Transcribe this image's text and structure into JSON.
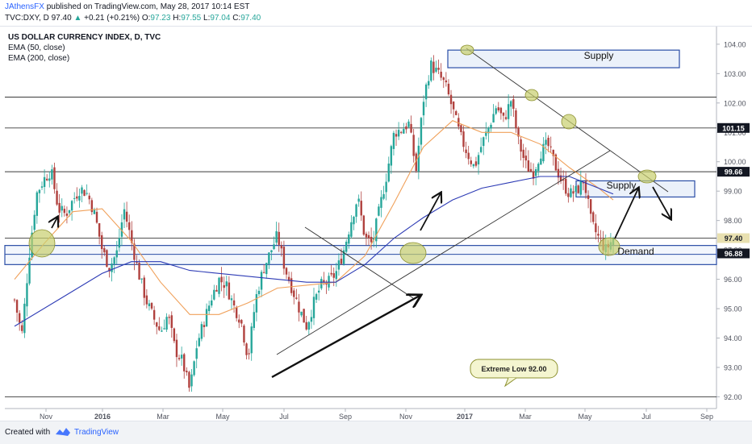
{
  "header": {
    "author": "JAthensFX",
    "published": "published on TradingView.com, May 28, 2017 10:14 EST",
    "symbol": "TVC:DXY, D",
    "last": "97.40",
    "change_arrow": "▲",
    "change": "+0.21 (+0.21%)",
    "o_label": "O:",
    "o_val": "97.23",
    "h_label": "H:",
    "h_val": "97.55",
    "l_label": "L:",
    "l_val": "97.04",
    "c_label": "C:",
    "c_val": "97.40"
  },
  "legend": {
    "title": "US DOLLAR CURRENCY INDEX, D, TVC",
    "ema1": "EMA (50, close)",
    "ema2": "EMA (200, close)"
  },
  "footer": {
    "created": "Created with",
    "brand": "TradingView"
  },
  "colors": {
    "bull": "#26a69a",
    "bear": "#b0413e",
    "ema50": "#f0a15b",
    "ema200": "#2d3bb5",
    "zone_border": "#2a4ea6",
    "zone_fill": "#e8eef9",
    "highlight": "#c8cf6e"
  },
  "chart_data": {
    "type": "candlestick",
    "title": "US DOLLAR CURRENCY INDEX, D, TVC",
    "y_axis": {
      "ticks": [
        "104.00",
        "103.00",
        "102.00",
        "101.00",
        "100.00",
        "99.00",
        "98.00",
        "97.00",
        "96.00",
        "95.00",
        "94.00",
        "93.00",
        "92.00"
      ],
      "ylim": [
        91.6,
        104.6
      ]
    },
    "x_axis": {
      "ticks": [
        "Nov",
        "2016",
        "Mar",
        "May",
        "Jul",
        "Sep",
        "Nov",
        "2017",
        "Mar",
        "May",
        "Jul",
        "Sep"
      ]
    },
    "price_labels": [
      "101.15",
      "99.66",
      "97.40",
      "96.88"
    ],
    "horizontal_levels": [
      101.15,
      102.2,
      99.66,
      97.4,
      92.0
    ],
    "zones": [
      {
        "label": "Supply",
        "low": 103.2,
        "high": 103.8
      },
      {
        "label": "Supply",
        "low": 98.8,
        "high": 99.35
      },
      {
        "label": "Demand",
        "low": 96.5,
        "high": 97.15
      }
    ],
    "close_path": [
      [
        0,
        95.3
      ],
      [
        1,
        94.1
      ],
      [
        2,
        96.8
      ],
      [
        3,
        98.9
      ],
      [
        4,
        99.4
      ],
      [
        5,
        99.7
      ],
      [
        6,
        98.4
      ],
      [
        7,
        98.2
      ],
      [
        8,
        98.7
      ],
      [
        9,
        99.1
      ],
      [
        10,
        98.9
      ],
      [
        11,
        98.2
      ],
      [
        12,
        97.0
      ],
      [
        13,
        96.4
      ],
      [
        14,
        96.9
      ],
      [
        15,
        98.4
      ],
      [
        16,
        97.3
      ],
      [
        17,
        96.2
      ],
      [
        18,
        95.3
      ],
      [
        19,
        94.7
      ],
      [
        20,
        94.2
      ],
      [
        21,
        94.8
      ],
      [
        22,
        93.6
      ],
      [
        23,
        93.2
      ],
      [
        24,
        92.2
      ],
      [
        25,
        93.8
      ],
      [
        26,
        94.6
      ],
      [
        27,
        95.4
      ],
      [
        28,
        96.0
      ],
      [
        29,
        95.8
      ],
      [
        30,
        95.1
      ],
      [
        31,
        94.6
      ],
      [
        32,
        93.3
      ],
      [
        33,
        95.3
      ],
      [
        34,
        96.3
      ],
      [
        35,
        96.9
      ],
      [
        36,
        97.5
      ],
      [
        37,
        96.4
      ],
      [
        38,
        95.7
      ],
      [
        39,
        95.0
      ],
      [
        40,
        94.4
      ],
      [
        41,
        95.2
      ],
      [
        42,
        95.8
      ],
      [
        43,
        95.9
      ],
      [
        44,
        96.2
      ],
      [
        45,
        96.9
      ],
      [
        46,
        97.9
      ],
      [
        47,
        98.8
      ],
      [
        48,
        97.4
      ],
      [
        49,
        97.2
      ],
      [
        50,
        98.4
      ],
      [
        51,
        99.6
      ],
      [
        52,
        101.0
      ],
      [
        53,
        101.1
      ],
      [
        54,
        101.3
      ],
      [
        55,
        99.7
      ],
      [
        56,
        102.1
      ],
      [
        57,
        103.3
      ],
      [
        58,
        103.0
      ],
      [
        59,
        102.6
      ],
      [
        60,
        101.8
      ],
      [
        61,
        100.9
      ],
      [
        62,
        100.3
      ],
      [
        63,
        99.8
      ],
      [
        64,
        100.6
      ],
      [
        65,
        101.2
      ],
      [
        66,
        101.9
      ],
      [
        67,
        101.4
      ],
      [
        68,
        102.1
      ],
      [
        69,
        100.7
      ],
      [
        70,
        99.9
      ],
      [
        71,
        99.6
      ],
      [
        72,
        100.3
      ],
      [
        73,
        100.6
      ],
      [
        74,
        99.9
      ],
      [
        75,
        99.3
      ],
      [
        76,
        98.9
      ],
      [
        77,
        99.0
      ],
      [
        78,
        99.4
      ],
      [
        79,
        97.9
      ],
      [
        80,
        97.4
      ],
      [
        81,
        97.0
      ],
      [
        82,
        97.4
      ]
    ],
    "ema50_path": [
      [
        0,
        96.0
      ],
      [
        4,
        97.2
      ],
      [
        8,
        98.3
      ],
      [
        12,
        98.4
      ],
      [
        16,
        97.3
      ],
      [
        20,
        95.9
      ],
      [
        24,
        94.8
      ],
      [
        28,
        94.8
      ],
      [
        32,
        95.2
      ],
      [
        36,
        95.7
      ],
      [
        40,
        95.8
      ],
      [
        44,
        95.9
      ],
      [
        48,
        96.8
      ],
      [
        52,
        98.6
      ],
      [
        56,
        100.5
      ],
      [
        60,
        101.4
      ],
      [
        64,
        101.0
      ],
      [
        68,
        101.0
      ],
      [
        72,
        100.6
      ],
      [
        76,
        99.8
      ],
      [
        80,
        99.1
      ],
      [
        82,
        98.7
      ]
    ],
    "ema200_path": [
      [
        0,
        94.4
      ],
      [
        6,
        95.3
      ],
      [
        12,
        96.2
      ],
      [
        16,
        96.6
      ],
      [
        20,
        96.6
      ],
      [
        24,
        96.3
      ],
      [
        28,
        96.2
      ],
      [
        32,
        96.1
      ],
      [
        36,
        96.0
      ],
      [
        40,
        95.9
      ],
      [
        44,
        95.9
      ],
      [
        48,
        96.5
      ],
      [
        52,
        97.4
      ],
      [
        56,
        98.1
      ],
      [
        60,
        98.7
      ],
      [
        64,
        99.1
      ],
      [
        68,
        99.3
      ],
      [
        72,
        99.5
      ],
      [
        76,
        99.5
      ],
      [
        80,
        99.1
      ],
      [
        82,
        98.9
      ]
    ],
    "annotations": [
      "Supply",
      "Supply",
      "Demand",
      "Extreme Low 92.00"
    ]
  }
}
